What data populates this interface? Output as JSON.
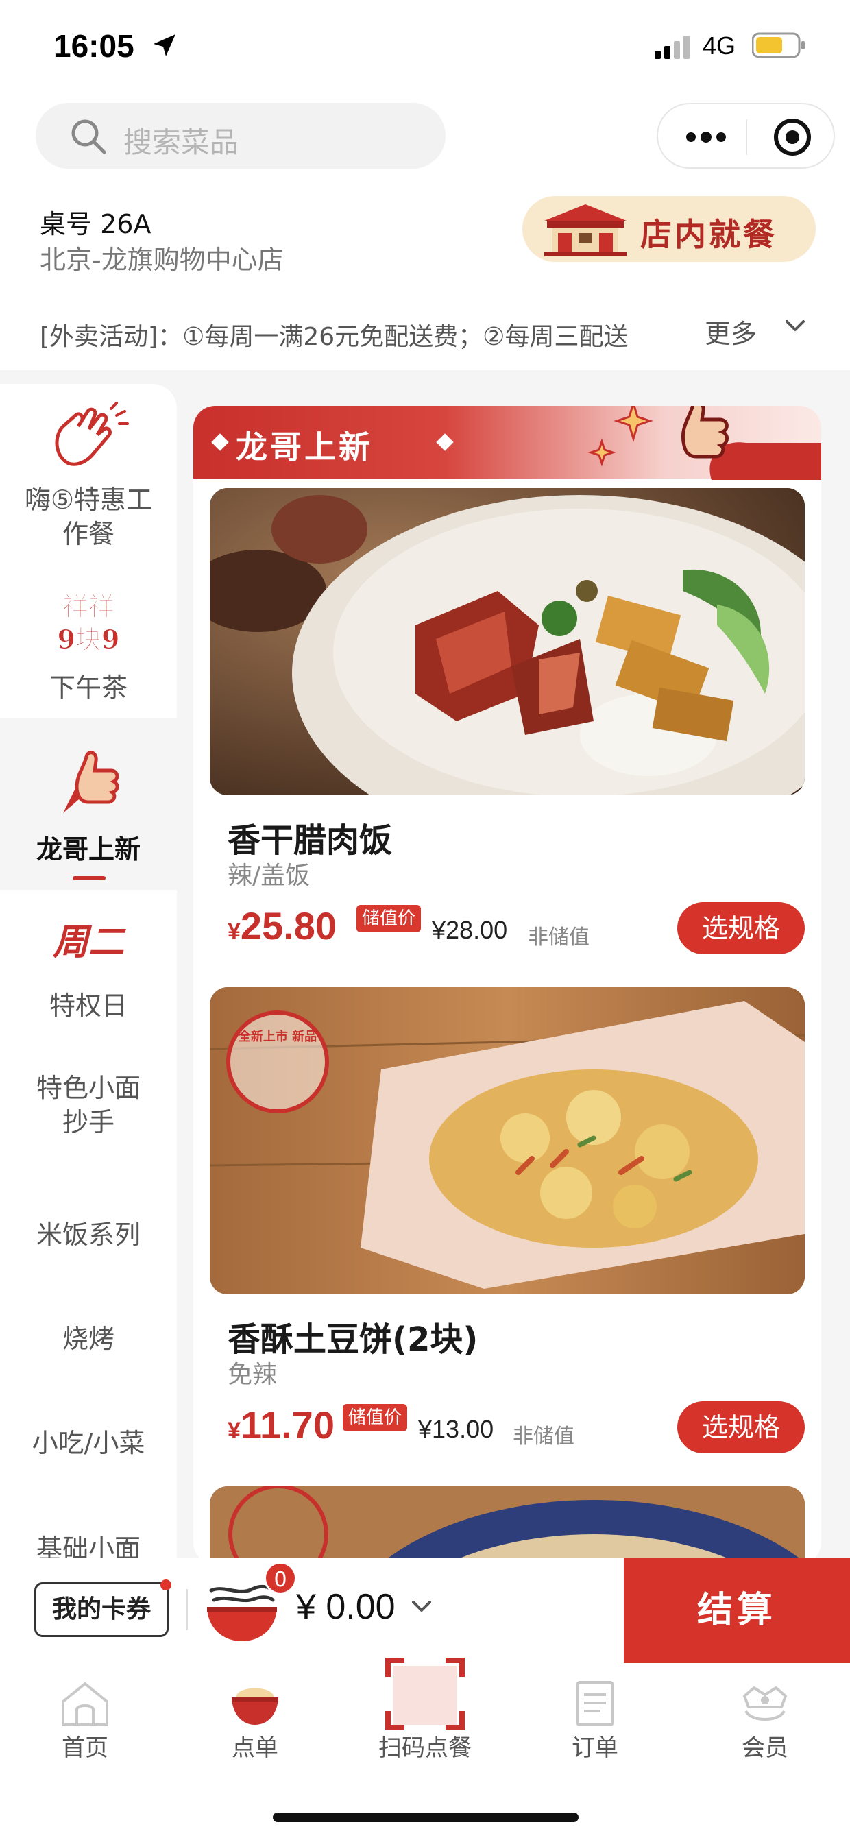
{
  "status_bar": {
    "time": "16:05",
    "network": "4G",
    "icons": [
      "location-arrow-icon",
      "signal-icon",
      "battery-icon"
    ],
    "battery_color": "#f4c430"
  },
  "search": {
    "placeholder": "搜索菜品"
  },
  "store": {
    "table_no": "桌号 26A",
    "name": "北京-龙旗购物中心店",
    "dine_mode": "店内就餐"
  },
  "promo": {
    "text": "[外卖活动]：①每周一满26元免配送费；②每周三配送",
    "more_label": "更多"
  },
  "sidebar": {
    "items": [
      {
        "label": "嗨⑤特惠工作餐",
        "icon": "clapping-hands-icon"
      },
      {
        "label": "下午茶",
        "icon": "xiangxiang-99-icon",
        "badge_text": "祥祥 9块9"
      },
      {
        "label": "龙哥上新",
        "icon": "thumbs-up-icon",
        "active": true
      },
      {
        "label": "特权日",
        "icon": "tuesday-icon",
        "badge_text": "周二"
      },
      {
        "label": "特色小面 抄手"
      },
      {
        "label": "米饭系列"
      },
      {
        "label": "烧烤"
      },
      {
        "label": "小吃/小菜"
      },
      {
        "label": "基础小面"
      }
    ]
  },
  "section": {
    "title": "龙哥上新"
  },
  "dishes": [
    {
      "name": "香干腊肉饭",
      "tag": "辣/盖饭",
      "currency": "¥",
      "price": "25.80",
      "stored_badge": "储值价",
      "alt_price": "¥28.00",
      "alt_label": "非储值",
      "button": "选规格"
    },
    {
      "name": "香酥土豆饼(2块)",
      "tag": "免辣",
      "currency": "¥",
      "price": "11.70",
      "stored_badge": "储值价",
      "alt_price": "¥13.00",
      "alt_label": "非储值",
      "button": "选规格",
      "badge": "全新上市 新品"
    }
  ],
  "cart": {
    "coupon_label": "我的卡券",
    "count": "0",
    "total": "¥ 0.00",
    "checkout_label": "结算"
  },
  "tabs": [
    {
      "label": "首页",
      "icon": "home-icon"
    },
    {
      "label": "点单",
      "icon": "bowl-icon"
    },
    {
      "label": "扫码点餐",
      "icon": "scan-icon"
    },
    {
      "label": "订单",
      "icon": "order-icon"
    },
    {
      "label": "会员",
      "icon": "member-icon"
    }
  ],
  "colors": {
    "brand_red": "#d6342b",
    "dine_in_bg": "#f8e9cd",
    "text_gray": "#888888"
  }
}
